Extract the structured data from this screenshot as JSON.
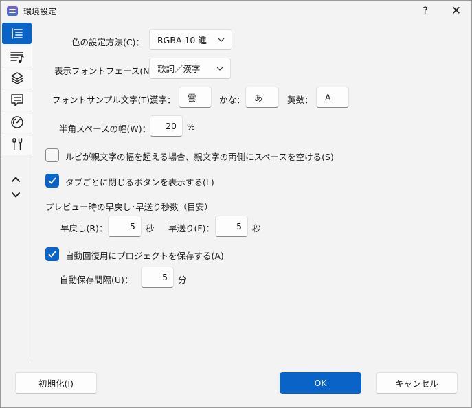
{
  "window": {
    "title": "環境設定",
    "help_label": "?",
    "close_label": "✕"
  },
  "colors": {
    "accent": "#0a64c8"
  },
  "sidebar": {
    "items": [
      {
        "icon": "list-icon",
        "active": true
      },
      {
        "icon": "lyrics-music-icon",
        "active": false
      },
      {
        "icon": "layers-icon",
        "active": false
      },
      {
        "icon": "comment-icon",
        "active": false
      },
      {
        "icon": "gauge-icon",
        "active": false
      },
      {
        "icon": "tools-icon",
        "active": false
      }
    ],
    "up_icon": "chevron-up-icon",
    "down_icon": "chevron-down-icon"
  },
  "settings": {
    "color_method": {
      "label": "色の設定方法(C)：",
      "value": "RGBA 10 進"
    },
    "font_face": {
      "label": "表示フォントフェース(N)：",
      "value": "歌詞／漢字"
    },
    "font_sample": {
      "label": "フォントサンプル文字(T)：",
      "kanji_label": "漢字：",
      "kanji_value": "雲",
      "kana_label": "かな：",
      "kana_value": "あ",
      "alpha_label": "英数：",
      "alpha_value": "A"
    },
    "halfwidth_space": {
      "label": "半角スペースの幅(W)：",
      "value": "20",
      "unit": "%"
    },
    "ruby_spacing": {
      "label": "ルビが親文字の幅を超える場合、親文字の両側にスペースを空ける(S)",
      "checked": false
    },
    "tab_close": {
      "label": "タブごとに閉じるボタンを表示する(L)",
      "checked": true
    },
    "preview_seconds": {
      "heading": "プレビュー時の早戻し･早送り秒数（目安）",
      "rewind_label": "早戻し(R)：",
      "rewind_value": "5",
      "rewind_unit": "秒",
      "forward_label": "早送り(F)：",
      "forward_value": "5",
      "forward_unit": "秒"
    },
    "autosave": {
      "label": "自動回復用にプロジェクトを保存する(A)",
      "checked": true
    },
    "autosave_interval": {
      "label": "自動保存間隔(U)：",
      "value": "5",
      "unit": "分"
    }
  },
  "footer": {
    "reset_label": "初期化(I)",
    "ok_label": "OK",
    "cancel_label": "キャンセル"
  }
}
